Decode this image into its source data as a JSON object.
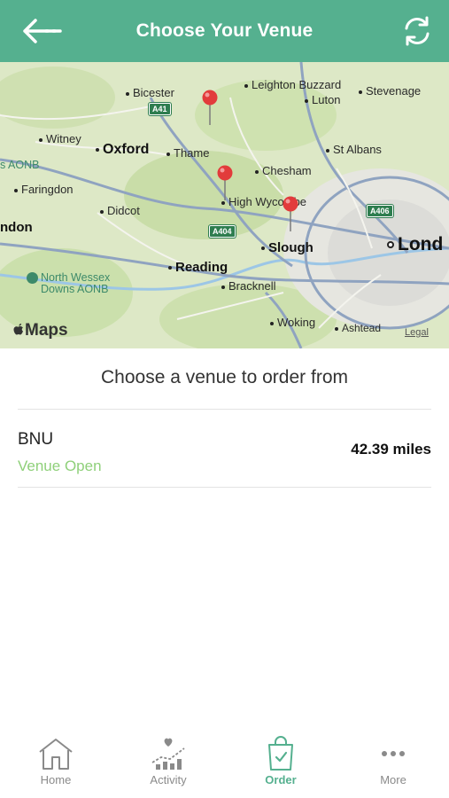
{
  "header": {
    "title": "Choose Your Venue",
    "back_icon": "arrow-left-icon",
    "refresh_icon": "refresh-icon",
    "color": "#55b08f"
  },
  "map": {
    "places": {
      "bicester": "Bicester",
      "leighton_buzzard": "Leighton Buzzard",
      "stevenage": "Stevenage",
      "luton": "Luton",
      "witney": "Witney",
      "oxford": "Oxford",
      "thame": "Thame",
      "st_albans": "St Albans",
      "aonb": "s AONB",
      "chesham": "Chesham",
      "faringdon": "Faringdon",
      "didcot": "Didcot",
      "high_wycombe": "High Wycombe",
      "london_left": "ndon",
      "slough": "Slough",
      "london": "Lond",
      "north_wessex_1": "North Wessex",
      "north_wessex_2": "Downs AONB",
      "reading": "Reading",
      "bracknell": "Bracknell",
      "woking": "Woking",
      "ashtead": "Ashtead"
    },
    "roads": {
      "a41": "A41",
      "a404": "A404",
      "a406": "A406"
    },
    "attribution": "Maps",
    "legal": "Legal",
    "pin_color": "#e23b3b"
  },
  "prompt": "Choose a venue to order from",
  "venues": [
    {
      "name": "BNU",
      "status": "Venue Open",
      "distance": "42.39 miles",
      "status_color": "#8fd07a"
    }
  ],
  "tabs": [
    {
      "label": "Home",
      "icon": "home-icon"
    },
    {
      "label": "Activity",
      "icon": "activity-icon"
    },
    {
      "label": "Order",
      "icon": "shopping-bag-icon",
      "active": true
    },
    {
      "label": "More",
      "icon": "more-icon"
    }
  ]
}
